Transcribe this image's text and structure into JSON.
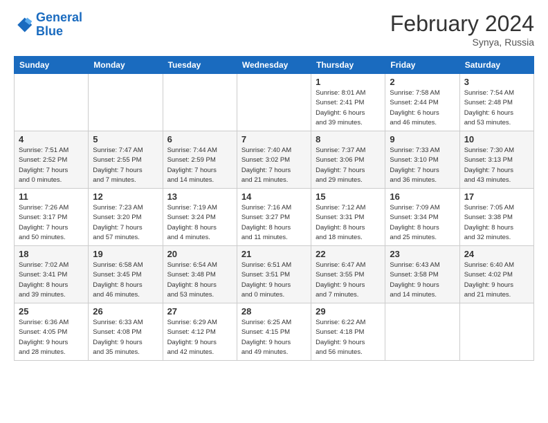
{
  "header": {
    "logo_line1": "General",
    "logo_line2": "Blue",
    "month": "February 2024",
    "location": "Synya, Russia"
  },
  "days_of_week": [
    "Sunday",
    "Monday",
    "Tuesday",
    "Wednesday",
    "Thursday",
    "Friday",
    "Saturday"
  ],
  "weeks": [
    [
      {
        "day": "",
        "info": ""
      },
      {
        "day": "",
        "info": ""
      },
      {
        "day": "",
        "info": ""
      },
      {
        "day": "",
        "info": ""
      },
      {
        "day": "1",
        "info": "Sunrise: 8:01 AM\nSunset: 2:41 PM\nDaylight: 6 hours\nand 39 minutes."
      },
      {
        "day": "2",
        "info": "Sunrise: 7:58 AM\nSunset: 2:44 PM\nDaylight: 6 hours\nand 46 minutes."
      },
      {
        "day": "3",
        "info": "Sunrise: 7:54 AM\nSunset: 2:48 PM\nDaylight: 6 hours\nand 53 minutes."
      }
    ],
    [
      {
        "day": "4",
        "info": "Sunrise: 7:51 AM\nSunset: 2:52 PM\nDaylight: 7 hours\nand 0 minutes."
      },
      {
        "day": "5",
        "info": "Sunrise: 7:47 AM\nSunset: 2:55 PM\nDaylight: 7 hours\nand 7 minutes."
      },
      {
        "day": "6",
        "info": "Sunrise: 7:44 AM\nSunset: 2:59 PM\nDaylight: 7 hours\nand 14 minutes."
      },
      {
        "day": "7",
        "info": "Sunrise: 7:40 AM\nSunset: 3:02 PM\nDaylight: 7 hours\nand 21 minutes."
      },
      {
        "day": "8",
        "info": "Sunrise: 7:37 AM\nSunset: 3:06 PM\nDaylight: 7 hours\nand 29 minutes."
      },
      {
        "day": "9",
        "info": "Sunrise: 7:33 AM\nSunset: 3:10 PM\nDaylight: 7 hours\nand 36 minutes."
      },
      {
        "day": "10",
        "info": "Sunrise: 7:30 AM\nSunset: 3:13 PM\nDaylight: 7 hours\nand 43 minutes."
      }
    ],
    [
      {
        "day": "11",
        "info": "Sunrise: 7:26 AM\nSunset: 3:17 PM\nDaylight: 7 hours\nand 50 minutes."
      },
      {
        "day": "12",
        "info": "Sunrise: 7:23 AM\nSunset: 3:20 PM\nDaylight: 7 hours\nand 57 minutes."
      },
      {
        "day": "13",
        "info": "Sunrise: 7:19 AM\nSunset: 3:24 PM\nDaylight: 8 hours\nand 4 minutes."
      },
      {
        "day": "14",
        "info": "Sunrise: 7:16 AM\nSunset: 3:27 PM\nDaylight: 8 hours\nand 11 minutes."
      },
      {
        "day": "15",
        "info": "Sunrise: 7:12 AM\nSunset: 3:31 PM\nDaylight: 8 hours\nand 18 minutes."
      },
      {
        "day": "16",
        "info": "Sunrise: 7:09 AM\nSunset: 3:34 PM\nDaylight: 8 hours\nand 25 minutes."
      },
      {
        "day": "17",
        "info": "Sunrise: 7:05 AM\nSunset: 3:38 PM\nDaylight: 8 hours\nand 32 minutes."
      }
    ],
    [
      {
        "day": "18",
        "info": "Sunrise: 7:02 AM\nSunset: 3:41 PM\nDaylight: 8 hours\nand 39 minutes."
      },
      {
        "day": "19",
        "info": "Sunrise: 6:58 AM\nSunset: 3:45 PM\nDaylight: 8 hours\nand 46 minutes."
      },
      {
        "day": "20",
        "info": "Sunrise: 6:54 AM\nSunset: 3:48 PM\nDaylight: 8 hours\nand 53 minutes."
      },
      {
        "day": "21",
        "info": "Sunrise: 6:51 AM\nSunset: 3:51 PM\nDaylight: 9 hours\nand 0 minutes."
      },
      {
        "day": "22",
        "info": "Sunrise: 6:47 AM\nSunset: 3:55 PM\nDaylight: 9 hours\nand 7 minutes."
      },
      {
        "day": "23",
        "info": "Sunrise: 6:43 AM\nSunset: 3:58 PM\nDaylight: 9 hours\nand 14 minutes."
      },
      {
        "day": "24",
        "info": "Sunrise: 6:40 AM\nSunset: 4:02 PM\nDaylight: 9 hours\nand 21 minutes."
      }
    ],
    [
      {
        "day": "25",
        "info": "Sunrise: 6:36 AM\nSunset: 4:05 PM\nDaylight: 9 hours\nand 28 minutes."
      },
      {
        "day": "26",
        "info": "Sunrise: 6:33 AM\nSunset: 4:08 PM\nDaylight: 9 hours\nand 35 minutes."
      },
      {
        "day": "27",
        "info": "Sunrise: 6:29 AM\nSunset: 4:12 PM\nDaylight: 9 hours\nand 42 minutes."
      },
      {
        "day": "28",
        "info": "Sunrise: 6:25 AM\nSunset: 4:15 PM\nDaylight: 9 hours\nand 49 minutes."
      },
      {
        "day": "29",
        "info": "Sunrise: 6:22 AM\nSunset: 4:18 PM\nDaylight: 9 hours\nand 56 minutes."
      },
      {
        "day": "",
        "info": ""
      },
      {
        "day": "",
        "info": ""
      }
    ]
  ]
}
